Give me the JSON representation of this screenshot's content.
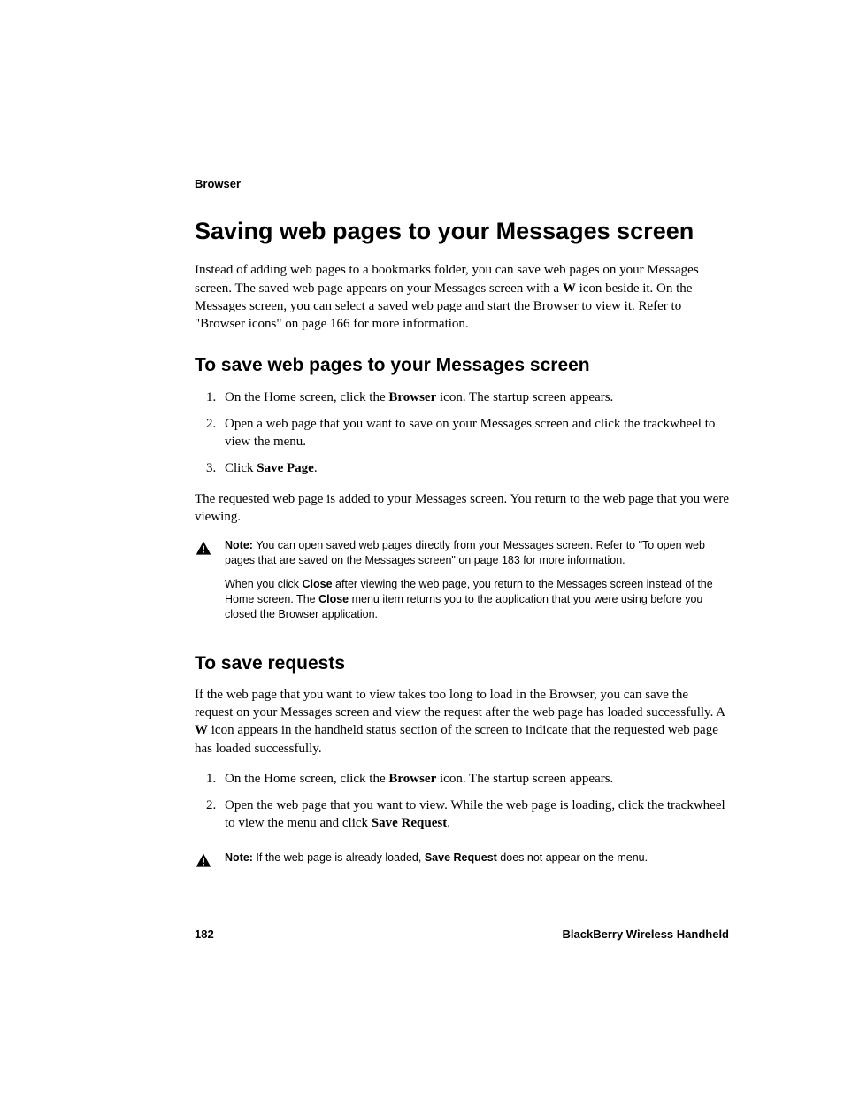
{
  "runningHead": "Browser",
  "title": "Saving web pages to your Messages screen",
  "intro": {
    "pre": "Instead of adding web pages to a bookmarks folder, you can save web pages on your Messages screen. The saved web page appears on your Messages screen with a ",
    "bold1": "W",
    "post": " icon beside it. On the Messages screen, you can select a saved web page and start the Browser to view it. Refer to \"Browser icons\" on page 166 for more information."
  },
  "section1": {
    "heading": "To save web pages to your Messages screen",
    "step1": {
      "pre": "On the Home screen, click the ",
      "bold": "Browser",
      "post": " icon. The startup screen appears."
    },
    "step2": "Open a web page that you want to save on your Messages screen and click the trackwheel to view the menu.",
    "step3": {
      "pre": "Click ",
      "bold": "Save Page",
      "post": "."
    },
    "after": "The requested web page is added to your Messages screen. You return to the web page that you were viewing."
  },
  "note1": {
    "label": "Note:",
    "p1": " You can open saved web pages directly from your Messages screen. Refer to \"To open web pages that are saved on the Messages screen\" on page 183 for more information.",
    "p2a": "When you click ",
    "p2b": "Close",
    "p2c": " after viewing the web page, you return to the Messages screen instead of the Home screen. The ",
    "p2d": "Close",
    "p2e": " menu item returns you to the application that you were using before you closed the Browser application."
  },
  "section2": {
    "heading": "To save requests",
    "para": {
      "pre": "If the web page that you want to view takes too long to load in the Browser, you can save the request on your Messages screen and view the request after the web page has loaded successfully. A ",
      "bold": "W",
      "post": " icon appears in the handheld status section of the screen to indicate that the requested web page has loaded successfully."
    },
    "step1": {
      "pre": "On the Home screen, click the ",
      "bold": "Browser",
      "post": " icon. The startup screen appears."
    },
    "step2": {
      "pre": "Open the web page that you want to view. While the web page is loading, click the trackwheel to view the menu and click ",
      "bold": "Save Request",
      "post": "."
    }
  },
  "note2": {
    "label": "Note:",
    "pre": " If the web page is already loaded, ",
    "bold": "Save Request",
    "post": " does not appear on the menu."
  },
  "footer": {
    "page": "182",
    "product": "BlackBerry Wireless Handheld"
  }
}
